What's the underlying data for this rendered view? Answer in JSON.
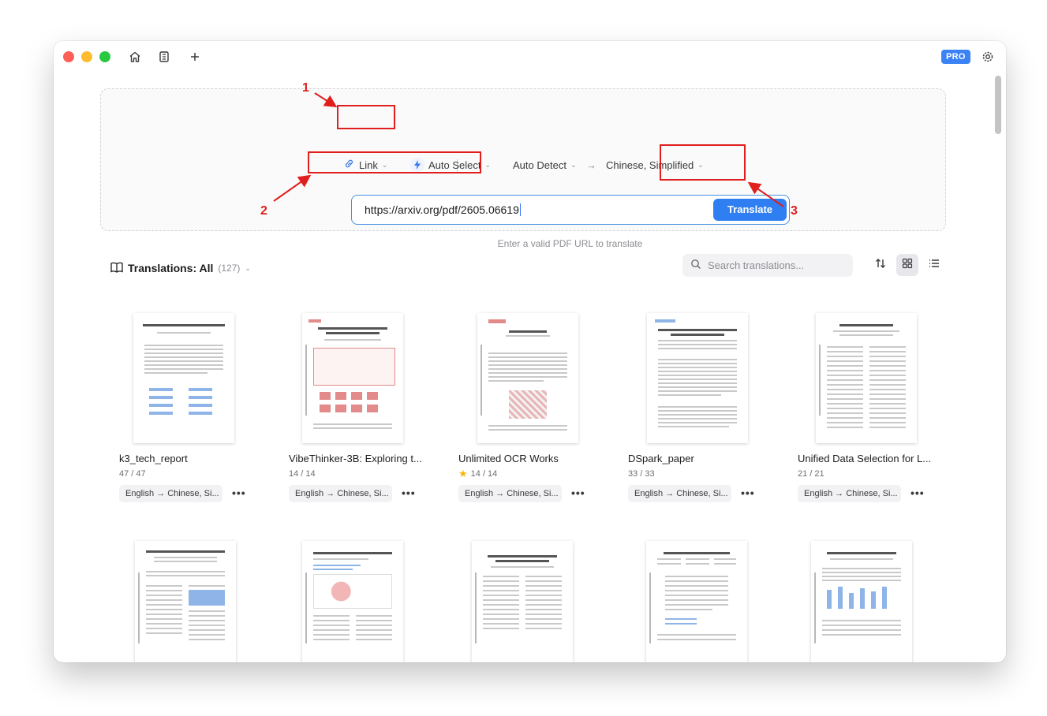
{
  "window": {
    "pro_badge": "PRO",
    "icons": [
      "home-icon",
      "document-list-icon",
      "plus-icon",
      "gear-icon"
    ]
  },
  "translate_panel": {
    "source_type": "Link",
    "engine": "Auto Select",
    "source_language": "Auto Detect",
    "target_language": "Chinese, Simplified",
    "url_value": "https://arxiv.org/pdf/2605.06619",
    "translate_button": "Translate",
    "hint": "Enter a valid PDF URL to translate"
  },
  "annotations": {
    "n1": "1",
    "n2": "2",
    "n3": "3"
  },
  "translations": {
    "title": "Translations: All",
    "count": "(127)",
    "search_placeholder": "Search translations...",
    "cards": [
      {
        "title": "k3_tech_report",
        "pages": "47 / 47",
        "lang": "English → Chinese, Si...",
        "starred": false
      },
      {
        "title": "VibeThinker-3B: Exploring t...",
        "pages": "14 / 14",
        "lang": "English → Chinese, Si...",
        "starred": false
      },
      {
        "title": "Unlimited OCR Works",
        "pages": "14 / 14",
        "lang": "English → Chinese, Si...",
        "starred": true
      },
      {
        "title": "DSpark_paper",
        "pages": "33 / 33",
        "lang": "English → Chinese, Si...",
        "starred": false
      },
      {
        "title": "Unified Data Selection for L...",
        "pages": "21 / 21",
        "lang": "English → Chinese, Si...",
        "starred": false
      }
    ],
    "more_label": "•••"
  },
  "colors": {
    "accent": "#2f7ff3",
    "annotation": "#e01e1e",
    "star": "#f5b70a"
  }
}
